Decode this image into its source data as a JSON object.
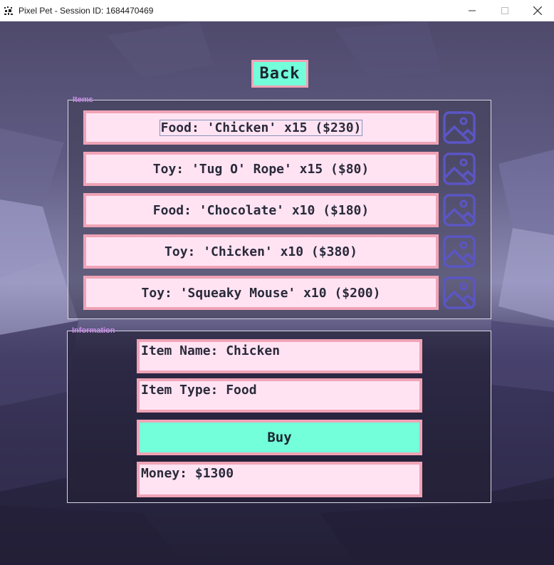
{
  "window": {
    "title": "Pixel Pet - Session ID: 1684470469"
  },
  "back_label": "Back",
  "items": {
    "label": "Items",
    "rows": [
      {
        "text": "Food: 'Chicken' x15 ($230)",
        "icon": "image-placeholder-icon"
      },
      {
        "text": "Toy: 'Tug O' Rope' x15 ($80)",
        "icon": "image-placeholder-icon"
      },
      {
        "text": "Food: 'Chocolate' x10 ($180)",
        "icon": "image-placeholder-icon"
      },
      {
        "text": "Toy: 'Chicken' x10 ($380)",
        "icon": "image-placeholder-icon"
      },
      {
        "text": "Toy: 'Squeaky Mouse' x10 ($200)",
        "icon": "image-placeholder-icon"
      }
    ]
  },
  "information": {
    "label": "Information",
    "item_name": "Item Name: Chicken",
    "item_type": "Item Type: Food",
    "buy_label": "Buy",
    "money": "Money: $1300"
  },
  "colors": {
    "accent": "#72ffd9",
    "field_bg": "#ffe3f3",
    "border": "#f0a3b6",
    "icon": "#5b55c4",
    "group_label": "#c98fe6"
  }
}
